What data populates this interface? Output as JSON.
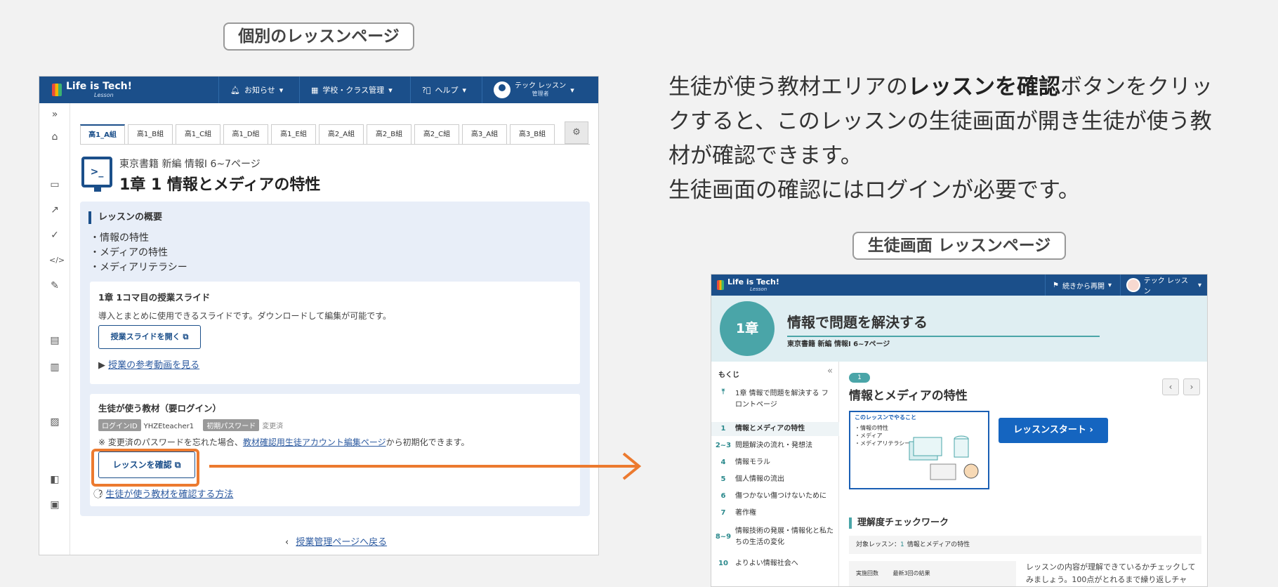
{
  "labels": {
    "teacher_page": "個別のレッスンページ",
    "student_page": "生徒画面 レッスンページ"
  },
  "description": {
    "line1_pre": "生徒が使う教材エリアの",
    "line1_bold": "レッスンを確認",
    "line1_post": "ボタンをクリックすると、このレッスンの生徒画面が開き生徒が使う教材が確認できます。",
    "line2": "生徒画面の確認にはログインが必要です。"
  },
  "teacher": {
    "logo": "Life is Tech!",
    "logo_sub": "Lesson",
    "nav": {
      "notice": "お知らせ",
      "school": "学校・クラス管理",
      "help": "ヘルプ",
      "user_name": "テック レッスン",
      "user_role": "管理者"
    },
    "tabs": [
      "高1_A組",
      "高1_B組",
      "高1_C組",
      "高1_D組",
      "高1_E組",
      "高2_A組",
      "高2_B組",
      "高2_C組",
      "高3_A組",
      "高3_B組"
    ],
    "lesson": {
      "book": "東京書籍 新編 情報I 6~7ページ",
      "title": "1章 1 情報とメディアの特性"
    },
    "overview": {
      "heading": "レッスンの概要",
      "items": [
        "・情報の特性",
        "・メディアの特性",
        "・メディアリテラシー"
      ]
    },
    "slides": {
      "heading": "1章 1コマ目の授業スライド",
      "desc": "導入とまとめに使用できるスライドです。ダウンロードして編集が可能です。",
      "button": "授業スライドを開く",
      "video_link": "授業の参考動画を見る"
    },
    "materials": {
      "heading": "生徒が使う教材（要ログイン）",
      "login_tag": "ログインID",
      "login_id": "YHZEteacher1",
      "pw_tag": "初期パスワード",
      "pw_value": "変更済",
      "note_pre": "※ 変更済のパスワードを忘れた場合、",
      "note_link": "教材確認用生徒アカウント編集ページ",
      "note_post": "から初期化できます。",
      "button": "レッスンを確認",
      "howto_link": "生徒が使う教材を確認する方法"
    },
    "back_link": "授業管理ページへ戻る"
  },
  "student": {
    "logo": "Life is Tech!",
    "logo_sub": "Lesson",
    "resume": "続きから再開",
    "user_name": "テック レッスン",
    "chapter": "1章",
    "chapter_title": "情報で問題を解決する",
    "book": "東京書籍 新編 情報I 6~7ページ",
    "toc_heading": "もくじ",
    "toc": [
      {
        "num": "",
        "label": "1章 情報で問題を解決する フロントページ"
      },
      {
        "num": "1",
        "label": "情報とメディアの特性"
      },
      {
        "num": "2~3",
        "label": "問題解決の流れ・発想法"
      },
      {
        "num": "4",
        "label": "情報モラル"
      },
      {
        "num": "5",
        "label": "個人情報の流出"
      },
      {
        "num": "6",
        "label": "傷つかない傷つけないために"
      },
      {
        "num": "7",
        "label": "著作権"
      },
      {
        "num": "8~9",
        "label": "情報技術の発展・情報化と私たちの生活の変化"
      },
      {
        "num": "10",
        "label": "よりよい情報社会へ"
      }
    ],
    "lesson_badge": "1",
    "lesson_title": "情報とメディアの特性",
    "thumb_title": "このレッスンでやること",
    "thumb_items": [
      "・情報の特性",
      "・メディア",
      "・メディアリテラシー"
    ],
    "start_button": "レッスンスタート",
    "check_heading": "理解度チェックワーク",
    "target_label": "対象レッスン：",
    "target_num": "1",
    "target_title": "情報とメディアの特性",
    "table_col1": "実施回数",
    "table_col2": "最新3回の結果",
    "guide": "レッスンの内容が理解できているかチェックしてみましょう。100点がとれるまで繰り返しチャ"
  },
  "colors": {
    "header_blue": "#1b4f8a",
    "highlight_orange": "#ec7a2f",
    "teal": "#4aa5a8",
    "button_blue": "#1565c0"
  }
}
